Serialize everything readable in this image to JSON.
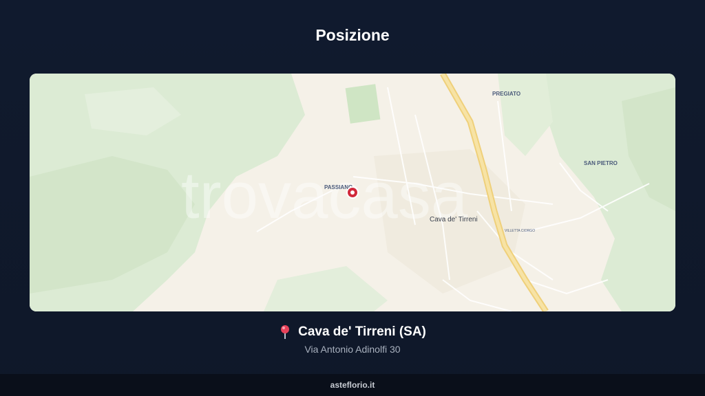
{
  "page": {
    "title": "Posizione"
  },
  "map": {
    "watermark": "trovacasa",
    "labels": {
      "passiano": "PASSIANO",
      "pregiato": "PREGIATO",
      "san_pietro": "SAN PIETRO",
      "cava": "Cava de' Tirreni",
      "villetta": "VILLETTA CIORGO"
    },
    "colors": {
      "marker": "#d1283a",
      "highway": "#f3d98a",
      "green": "#dcebd4"
    }
  },
  "location": {
    "city": "Cava de' Tirreni (SA)",
    "address": "Via Antonio Adinolfi 30"
  },
  "footer": {
    "site": "asteflorio.it"
  }
}
